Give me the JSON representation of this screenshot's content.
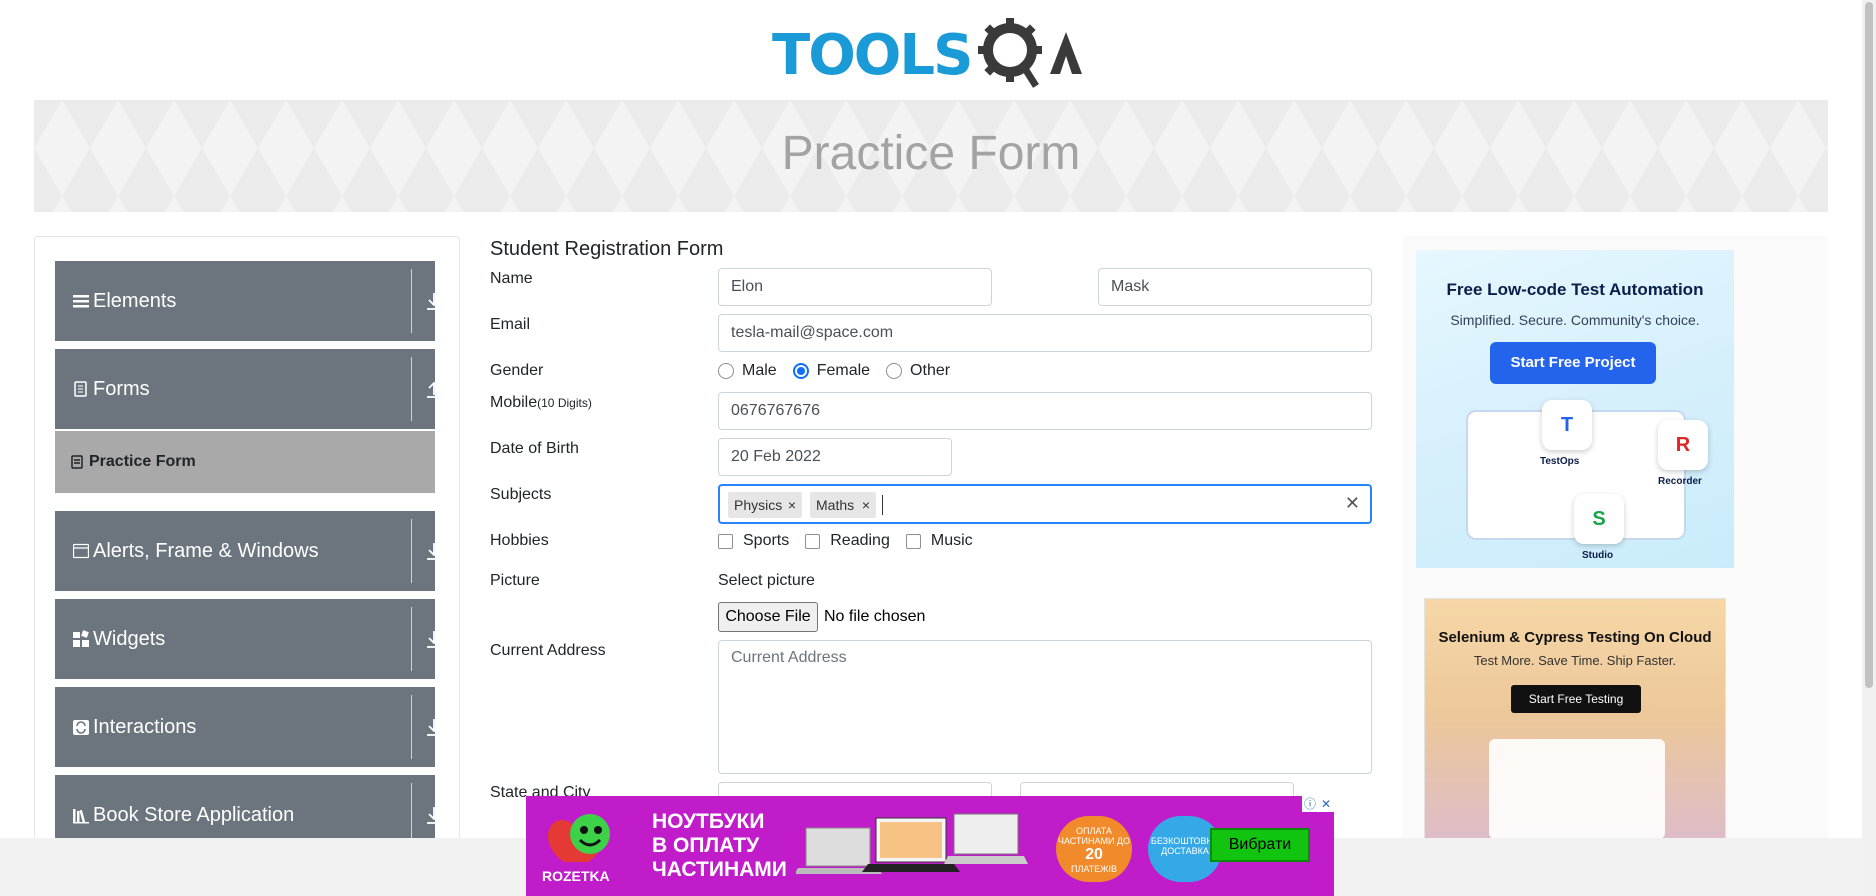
{
  "header": {
    "logo_text": "TOOLSQA",
    "banner_title": "Practice Form"
  },
  "sidebar": {
    "groups": [
      {
        "label": "Elements",
        "icon": "hamburger-icon",
        "state": "collapsed"
      },
      {
        "label": "Forms",
        "icon": "document-icon",
        "state": "expanded"
      },
      {
        "label": "Alerts, Frame & Windows",
        "icon": "window-icon",
        "state": "collapsed"
      },
      {
        "label": "Widgets",
        "icon": "widgets-icon",
        "state": "collapsed"
      },
      {
        "label": "Interactions",
        "icon": "interactions-icon",
        "state": "collapsed"
      },
      {
        "label": "Book Store Application",
        "icon": "books-icon",
        "state": "collapsed"
      }
    ],
    "active_item": "Practice Form"
  },
  "form": {
    "title": "Student Registration Form",
    "name_label": "Name",
    "first_name": "Elon",
    "last_name": "Mask",
    "email_label": "Email",
    "email": "tesla-mail@space.com",
    "gender_label": "Gender",
    "genders": [
      "Male",
      "Female",
      "Other"
    ],
    "gender_selected": "Female",
    "mobile_label": "Mobile",
    "mobile_hint": "(10 Digits)",
    "mobile": "0676767676",
    "dob_label": "Date of Birth",
    "dob": "20 Feb 2022",
    "subjects_label": "Subjects",
    "subjects": [
      "Physics",
      "Maths"
    ],
    "hobbies_label": "Hobbies",
    "hobbies": [
      "Sports",
      "Reading",
      "Music"
    ],
    "picture_label": "Picture",
    "select_picture": "Select picture",
    "choose_file": "Choose File",
    "no_file": "No file chosen",
    "address_label": "Current Address",
    "address_placeholder": "Current Address",
    "state_city_label": "State and City"
  },
  "ads": {
    "ad1": {
      "title": "Free Low-code Test Automation",
      "subtitle": "Simplified. Secure. Community's choice.",
      "button": "Start Free Project",
      "tiles": [
        "TestOps",
        "Recorder",
        "Studio"
      ]
    },
    "ad2": {
      "title": "Selenium & Cypress Testing On Cloud",
      "subtitle": "Test More. Save Time. Ship Faster.",
      "button": "Start Free Testing"
    },
    "bottom": {
      "headline_1": "НОУТБУКИ",
      "headline_2": "В ОПЛАТУ",
      "headline_3": "ЧАСТИНАМИ",
      "brand": "ROZETKA",
      "badge1_text": "ОПЛАТА ЧАСТИНАМИ ДО",
      "badge1_num": "20",
      "badge1_sub": "ПЛАТЕЖІВ",
      "badge2_text": "БЕЗКОШТОВНА ДОСТАВКА",
      "cta": "Вибрати"
    }
  },
  "colors": {
    "menu_bg": "#6c757d",
    "active_item_bg": "#a9a9a9",
    "focus_border": "#2684ff",
    "radio_selected": "#0d6efd",
    "logo_blue": "#1a9ad6",
    "bottom_ad_bg": "#c11cc9"
  }
}
